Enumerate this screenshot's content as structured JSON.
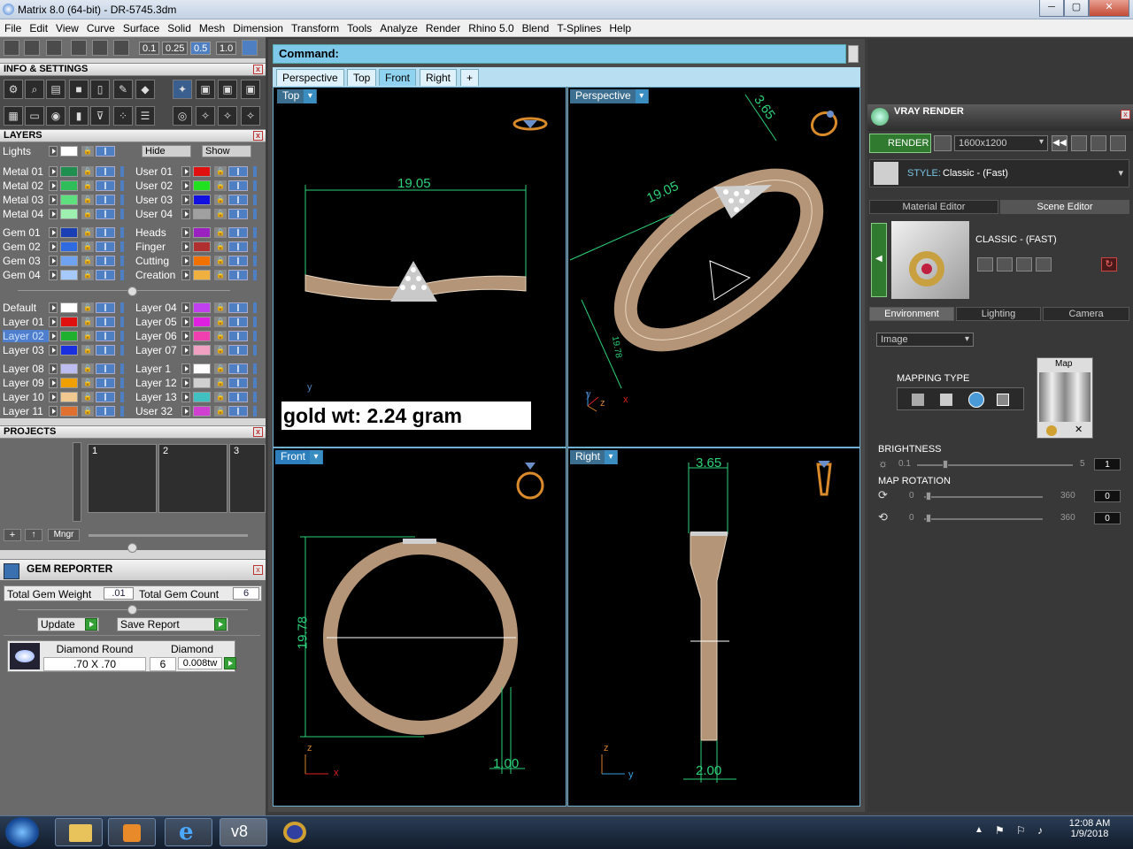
{
  "window": {
    "title": "Matrix 8.0 (64-bit) - DR-5745.3dm",
    "min": "─",
    "max": "▢",
    "close": "✕"
  },
  "menu": [
    "File",
    "Edit",
    "View",
    "Curve",
    "Surface",
    "Solid",
    "Mesh",
    "Dimension",
    "Transform",
    "Tools",
    "Analyze",
    "Render",
    "Rhino 5.0",
    "Blend",
    "T-Splines",
    "Help"
  ],
  "toolbar": {
    "zoom_values": [
      "0.1",
      "0.25",
      "0.5",
      "1.0"
    ],
    "zoom_selected": "0.5"
  },
  "info": {
    "title": "INFO & SETTINGS"
  },
  "layers": {
    "title": "LAYERS",
    "lights": "Lights",
    "hide": "Hide",
    "show": "Show",
    "left": [
      {
        "name": "Metal 01",
        "color": "#1f8f4f"
      },
      {
        "name": "Metal 02",
        "color": "#2fbd5a"
      },
      {
        "name": "Metal 03",
        "color": "#5fe07f"
      },
      {
        "name": "Metal 04",
        "color": "#9ef0b0"
      },
      {
        "name": "Gem 01",
        "color": "#1a3fb5"
      },
      {
        "name": "Gem 02",
        "color": "#2f6ae0"
      },
      {
        "name": "Gem 03",
        "color": "#6fa3f2"
      },
      {
        "name": "Gem 04",
        "color": "#a4c9fa"
      },
      {
        "name": "Default",
        "color": "#ffffff"
      },
      {
        "name": "Layer 01",
        "color": "#e01010"
      },
      {
        "name": "Layer 02",
        "color": "#20b030"
      },
      {
        "name": "Layer 03",
        "color": "#1a2fe0"
      },
      {
        "name": "Layer 08",
        "color": "#bcbcf0"
      },
      {
        "name": "Layer 09",
        "color": "#f0a000"
      },
      {
        "name": "Layer 10",
        "color": "#f0c890"
      },
      {
        "name": "Layer 11",
        "color": "#e07030"
      }
    ],
    "right": [
      {
        "name": "User 01",
        "color": "#e01010"
      },
      {
        "name": "User 02",
        "color": "#20e020"
      },
      {
        "name": "User 03",
        "color": "#1010e0"
      },
      {
        "name": "User 04",
        "color": "#a0a0a0"
      },
      {
        "name": "Heads",
        "color": "#9a20c0"
      },
      {
        "name": "Finger",
        "color": "#b03030"
      },
      {
        "name": "Cutting",
        "color": "#f07000"
      },
      {
        "name": "Creation",
        "color": "#f0b040"
      },
      {
        "name": "Layer 04",
        "color": "#c040f0"
      },
      {
        "name": "Layer 05",
        "color": "#e020e0"
      },
      {
        "name": "Layer 06",
        "color": "#f040b0"
      },
      {
        "name": "Layer 07",
        "color": "#f0a0c0"
      },
      {
        "name": "Layer 1",
        "color": "#ffffff"
      },
      {
        "name": "Layer 12",
        "color": "#d0d0d0"
      },
      {
        "name": "Layer 13",
        "color": "#40c0c0"
      },
      {
        "name": "User 32",
        "color": "#d040d0"
      }
    ]
  },
  "projects": {
    "title": "PROJECTS",
    "slots": [
      "1",
      "2",
      "3"
    ],
    "mngr": "Mngr",
    "add": "+"
  },
  "gem_reporter": {
    "title": "GEM REPORTER",
    "total_weight_label": "Total Gem Weight",
    "total_weight": ".01",
    "total_count_label": "Total Gem Count",
    "total_count": "6",
    "update": "Update",
    "save_report": "Save Report",
    "row": {
      "shape": "Diamond Round",
      "size": ".70 X .70",
      "type": "Diamond",
      "count": "6",
      "weight": "0.008tw"
    }
  },
  "command": {
    "label": "Command:"
  },
  "view_tabs": [
    "Perspective",
    "Top",
    "Front",
    "Right",
    "+"
  ],
  "view_tab_active": "Front",
  "viewports": {
    "top": {
      "label": "Top",
      "dim": "19.05",
      "axis_y": "y"
    },
    "perspective": {
      "label": "Perspective",
      "dim1": "3.65",
      "dim2": "19.05",
      "dim3": "19.78",
      "axis_y": "y",
      "axis_z": "z",
      "axis_x": "x"
    },
    "front": {
      "label": "Front",
      "dim1": "19.78",
      "dim2": "1.00",
      "axis_z": "z",
      "axis_x": "x"
    },
    "right": {
      "label": "Right",
      "dim1": "3.65",
      "dim2": "2.00",
      "axis_z": "z",
      "axis_y": "y"
    }
  },
  "gold_weight": "gold wt: 2.24 gram",
  "vray": {
    "title": "VRAY RENDER",
    "render": "RENDER",
    "resolution": "1600x1200",
    "style_label": "STYLE:",
    "style_value": "Classic - (Fast)",
    "tabs": [
      "Material Editor",
      "Scene Editor"
    ],
    "tab_active": "Scene Editor",
    "scene_name": "CLASSIC - (FAST)",
    "env_tabs": [
      "Environment",
      "Lighting",
      "Camera"
    ],
    "env_tab_active": "Environment",
    "image_select": "Image",
    "mapping_type": "MAPPING TYPE",
    "map_label": "Map",
    "brightness": {
      "label": "BRIGHTNESS",
      "min": "0.1",
      "max": "5",
      "value": "1"
    },
    "map_rotation": {
      "label": "MAP ROTATION",
      "row1": {
        "min": "0",
        "max": "360",
        "value": "0"
      },
      "row2": {
        "min": "0",
        "max": "360",
        "value": "0"
      }
    }
  },
  "taskbar": {
    "time": "12:08 AM",
    "date": "1/9/2018"
  }
}
